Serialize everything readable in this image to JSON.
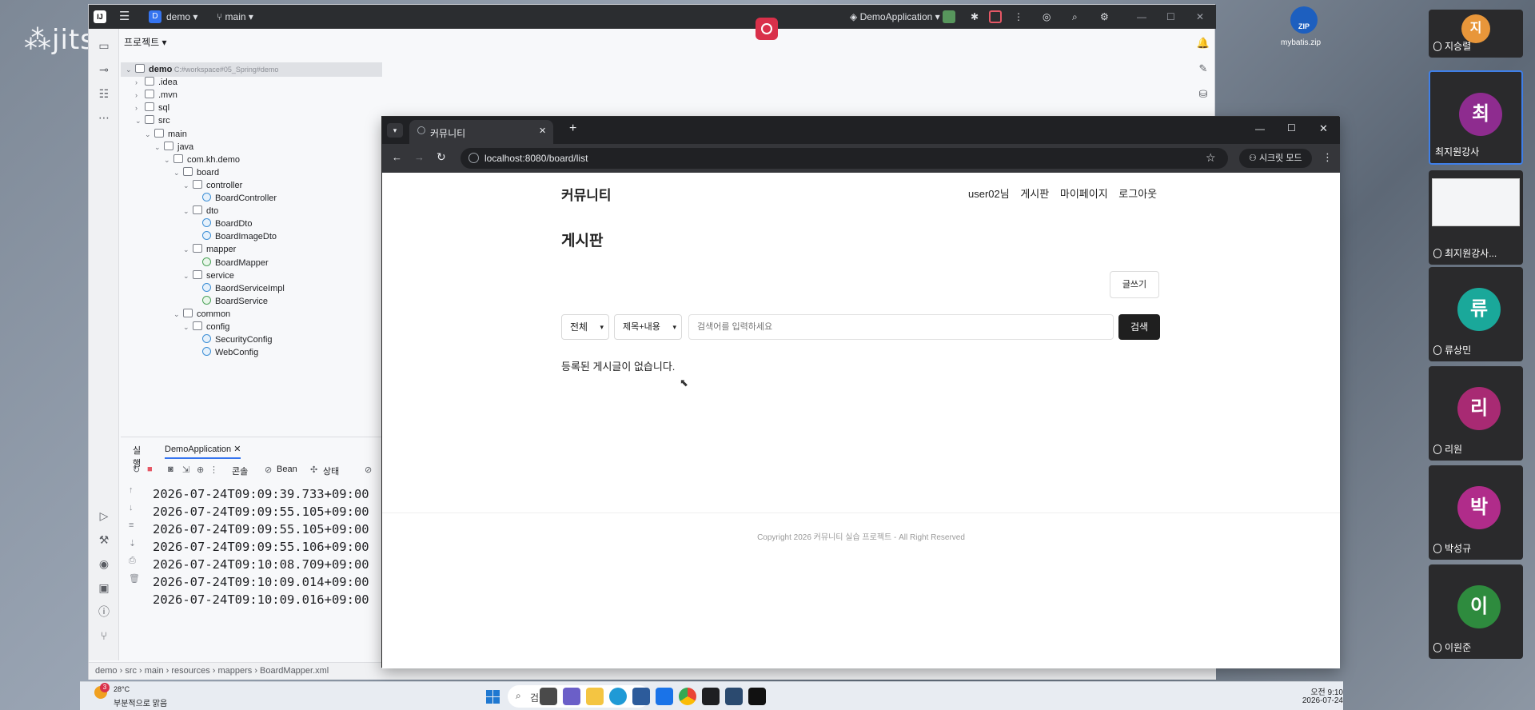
{
  "meeting": {
    "brand": "jitsi",
    "zip_label": "ZIP",
    "zip_file": "mybatis.zip",
    "participants": [
      {
        "initial": "지",
        "name": "지승렬",
        "color": "#e8963a"
      },
      {
        "initial": "최",
        "name": "최지원강사",
        "color": "#8e2c8f"
      },
      {
        "initial": "",
        "name": "최지원강사...",
        "color": "#2a2a2c"
      },
      {
        "initial": "류",
        "name": "류상민",
        "color": "#1aa89a"
      },
      {
        "initial": "리",
        "name": "리원",
        "color": "#a82a73"
      },
      {
        "initial": "박",
        "name": "박성규",
        "color": "#b02c8a"
      },
      {
        "initial": "이",
        "name": "이원준",
        "color": "#2e8b3e"
      }
    ]
  },
  "ide": {
    "project_badge": "D",
    "project_name": "demo",
    "branch": "main",
    "run_config": "DemoApplication",
    "panel_title": "프로젝트",
    "tree": [
      {
        "label": "demo",
        "extra": "C:#workspace#05_Spring#demo",
        "depth": 0,
        "kind": "folder",
        "open": true,
        "selected": true
      },
      {
        "label": ".idea",
        "depth": 1,
        "kind": "folder"
      },
      {
        "label": ".mvn",
        "depth": 1,
        "kind": "folder"
      },
      {
        "label": "sql",
        "depth": 1,
        "kind": "folder"
      },
      {
        "label": "src",
        "depth": 1,
        "kind": "folder",
        "open": true
      },
      {
        "label": "main",
        "depth": 2,
        "kind": "folder",
        "open": true
      },
      {
        "label": "java",
        "depth": 3,
        "kind": "folder",
        "open": true
      },
      {
        "label": "com.kh.demo",
        "depth": 4,
        "kind": "folder",
        "open": true
      },
      {
        "label": "board",
        "depth": 5,
        "kind": "folder",
        "open": true
      },
      {
        "label": "controller",
        "depth": 6,
        "kind": "folder",
        "open": true
      },
      {
        "label": "BoardController",
        "depth": 7,
        "kind": "class"
      },
      {
        "label": "dto",
        "depth": 6,
        "kind": "folder",
        "open": true
      },
      {
        "label": "BoardDto",
        "depth": 7,
        "kind": "class"
      },
      {
        "label": "BoardImageDto",
        "depth": 7,
        "kind": "class"
      },
      {
        "label": "mapper",
        "depth": 6,
        "kind": "folder",
        "open": true
      },
      {
        "label": "BoardMapper",
        "depth": 7,
        "kind": "interface"
      },
      {
        "label": "service",
        "depth": 6,
        "kind": "folder",
        "open": true
      },
      {
        "label": "BaordServiceImpl",
        "depth": 7,
        "kind": "class"
      },
      {
        "label": "BoardService",
        "depth": 7,
        "kind": "interface"
      },
      {
        "label": "common",
        "depth": 5,
        "kind": "folder",
        "open": true
      },
      {
        "label": "config",
        "depth": 6,
        "kind": "folder",
        "open": true
      },
      {
        "label": "SecurityConfig",
        "depth": 7,
        "kind": "class"
      },
      {
        "label": "WebConfig",
        "depth": 7,
        "kind": "class"
      }
    ],
    "run": {
      "title": "실행",
      "tab": "DemoApplication",
      "subtabs": [
        "콘솔",
        "Bean",
        "상태"
      ],
      "log": [
        "2026-07-24T09:09:39.733+09:00",
        "2026-07-24T09:09:55.105+09:00",
        "2026-07-24T09:09:55.105+09:00",
        "2026-07-24T09:09:55.106+09:00",
        "2026-07-24T09:10:08.709+09:00",
        "2026-07-24T09:10:09.014+09:00",
        "2026-07-24T09:10:09.016+09:00"
      ]
    },
    "breadcrumb": [
      "demo",
      "src",
      "main",
      "resources",
      "mappers",
      "BoardMapper.xml"
    ]
  },
  "browser": {
    "tab_title": "커뮤니티",
    "url": "localhost:8080/board/list",
    "secret_mode": "시크릿 모드",
    "site": {
      "brand": "커뮤니티",
      "nav": [
        "user02님",
        "게시판",
        "마이페이지",
        "로그아웃"
      ],
      "heading": "게시판",
      "write_button": "글쓰기",
      "filter_select": "전체",
      "field_select": "제목+내용",
      "search_placeholder": "검색어를 입력하세요",
      "search_button": "검색",
      "empty_message": "등록된 게시글이 없습니다.",
      "footer": "Copyright 2026 커뮤니티 실습 프로젝트 - All Right Reserved"
    }
  },
  "taskbar": {
    "weather_temp": "28°C",
    "weather_desc": "부분적으로 맑음",
    "search_placeholder": "검색",
    "time": "오전 9:10",
    "date": "2026-07-24",
    "badge": "3"
  }
}
